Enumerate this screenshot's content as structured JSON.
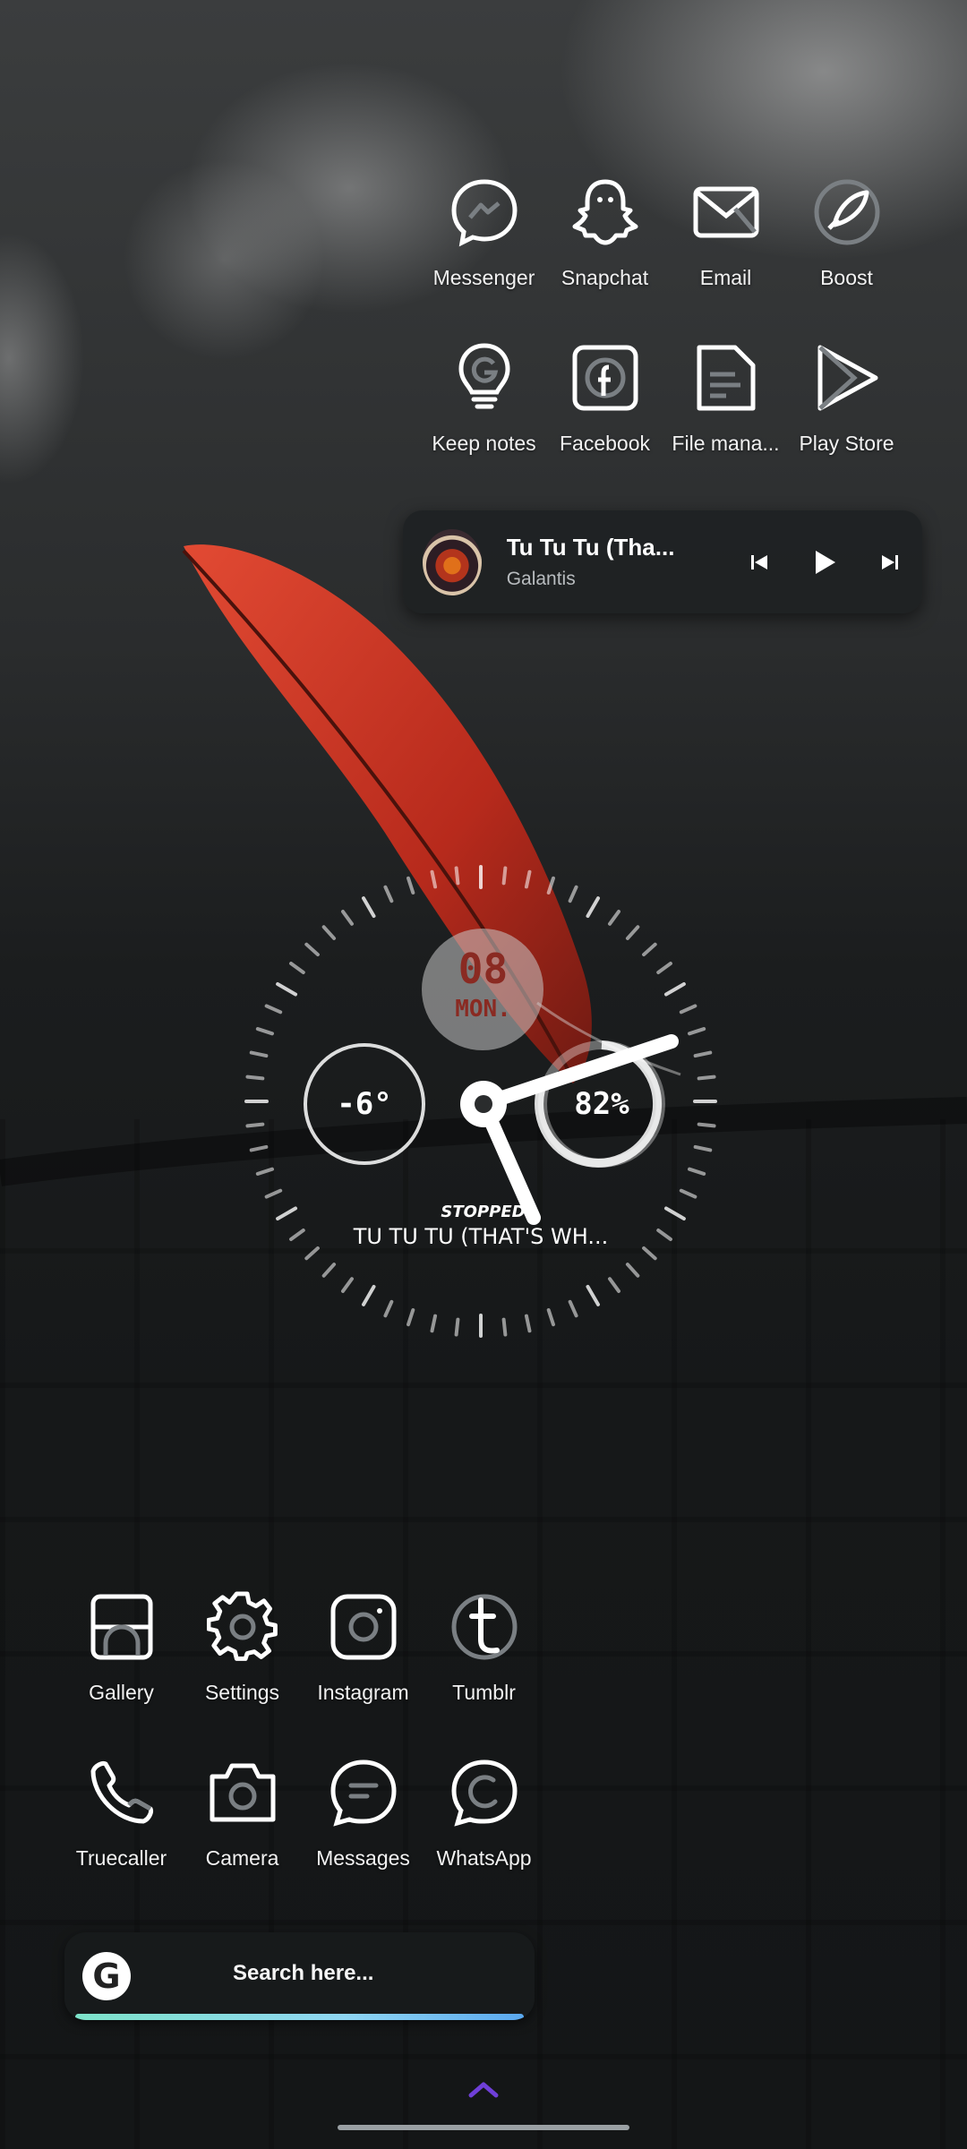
{
  "home": {
    "top_row_1": [
      {
        "label": "Messenger",
        "icon": "messenger-icon"
      },
      {
        "label": "Snapchat",
        "icon": "snapchat-icon"
      },
      {
        "label": "Email",
        "icon": "email-icon"
      },
      {
        "label": "Boost",
        "icon": "rocket-icon"
      }
    ],
    "top_row_2": [
      {
        "label": "Keep notes",
        "icon": "lightbulb-icon"
      },
      {
        "label": "Facebook",
        "icon": "facebook-icon"
      },
      {
        "label": "File mana...",
        "icon": "file-manager-icon"
      },
      {
        "label": "Play Store",
        "icon": "play-store-icon"
      }
    ],
    "bottom_row_1": [
      {
        "label": "Gallery",
        "icon": "gallery-icon"
      },
      {
        "label": "Settings",
        "icon": "gear-icon"
      },
      {
        "label": "Instagram",
        "icon": "instagram-icon"
      },
      {
        "label": "Tumblr",
        "icon": "tumblr-icon"
      }
    ],
    "bottom_row_2": [
      {
        "label": "Truecaller",
        "icon": "phone-icon"
      },
      {
        "label": "Camera",
        "icon": "camera-icon"
      },
      {
        "label": "Messages",
        "icon": "messages-icon"
      },
      {
        "label": "WhatsApp",
        "icon": "whatsapp-icon"
      }
    ]
  },
  "music": {
    "title": "Tu Tu Tu (Tha...",
    "artist": "Galantis"
  },
  "clock_widget": {
    "day": "08",
    "weekday": "MON.",
    "temperature": "-6°",
    "battery": "82%",
    "status": "STOPPED",
    "track": "TU TU TU (THAT'S WH..."
  },
  "search": {
    "logo": "G",
    "placeholder": "Search here..."
  },
  "colors": {
    "accent_gradient_start": "#7de3c9",
    "accent_gradient_end": "#5aa8ef",
    "chevron": "#6f3fd8",
    "feather": "#c8321f"
  }
}
